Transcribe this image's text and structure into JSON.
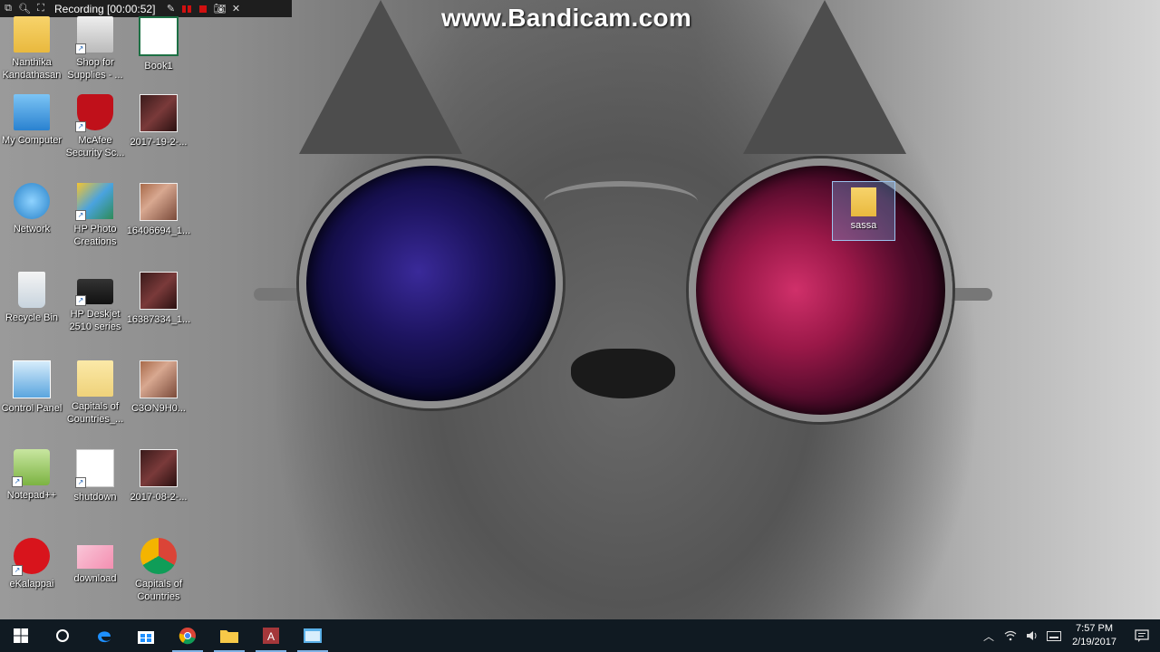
{
  "recorder": {
    "status": "Recording [00:00:52]"
  },
  "watermark": "www.Bandicam.com",
  "desktop_icons": [
    {
      "label": "Nanthika Kandathasan",
      "icon": "user-folder-icon"
    },
    {
      "label": "Shop for Supplies - ...",
      "icon": "printer-shop-icon"
    },
    {
      "label": "Book1",
      "icon": "excel-icon"
    },
    {
      "label": "My Computer",
      "icon": "computer-icon"
    },
    {
      "label": "McAfee Security Sc...",
      "icon": "mcafee-icon"
    },
    {
      "label": "2017-19-2-...",
      "icon": "photo-icon"
    },
    {
      "label": "Network",
      "icon": "network-icon"
    },
    {
      "label": "HP Photo Creations",
      "icon": "hp-photo-icon"
    },
    {
      "label": "16406694_1...",
      "icon": "photo-icon"
    },
    {
      "label": "Recycle Bin",
      "icon": "recycle-bin-icon"
    },
    {
      "label": "HP Deskjet 2510 series",
      "icon": "printer-icon"
    },
    {
      "label": "16387334_1...",
      "icon": "photo-icon"
    },
    {
      "label": "Control Panel",
      "icon": "control-panel-icon"
    },
    {
      "label": "Capitals of Countries_...",
      "icon": "folder-icon"
    },
    {
      "label": "C3ON9H0...",
      "icon": "photo-icon"
    },
    {
      "label": "Notepad++",
      "icon": "notepad-plus-icon"
    },
    {
      "label": "shutdown",
      "icon": "shutdown-icon"
    },
    {
      "label": "2017-08-2-...",
      "icon": "photo-icon"
    },
    {
      "label": "eKalappai",
      "icon": "ekalappai-icon"
    },
    {
      "label": "download",
      "icon": "image-icon"
    },
    {
      "label": "Capitals of Countries",
      "icon": "chrome-icon"
    }
  ],
  "floating_folder": {
    "label": "sassa"
  },
  "taskbar": {
    "apps": [
      "start-icon",
      "cortana-icon",
      "edge-icon",
      "store-icon",
      "chrome-icon",
      "file-explorer-icon",
      "access-icon",
      "app-window-icon"
    ],
    "time": "7:57 PM",
    "date": "2/19/2017"
  }
}
